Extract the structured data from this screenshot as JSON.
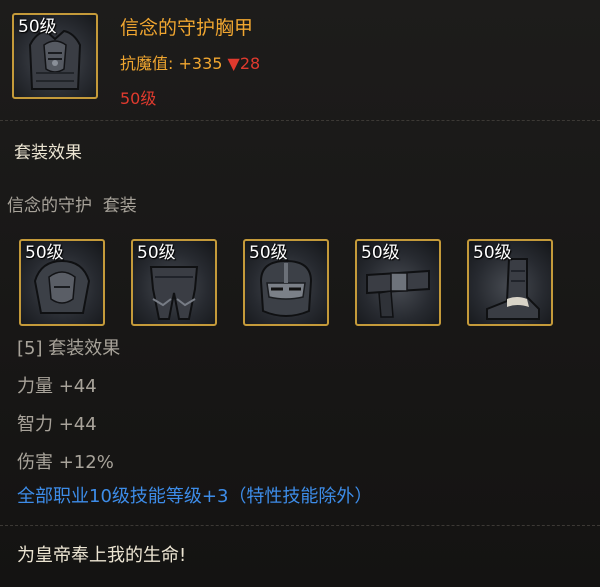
{
  "item": {
    "level_badge": "50级",
    "icon": "chest-armor-icon",
    "name": "信念的守护胸甲",
    "stat_label": "抗魔值",
    "stat_sep": ": ",
    "stat_value": "+335",
    "stat_diff": "▼28",
    "required_level": "50级"
  },
  "set": {
    "section_title": "套装效果",
    "name_line": "信念的守护  套装",
    "pieces": [
      {
        "level": "50级",
        "icon": "shoulder-armor-icon"
      },
      {
        "level": "50级",
        "icon": "leg-armor-icon"
      },
      {
        "level": "50级",
        "icon": "helmet-icon"
      },
      {
        "level": "50级",
        "icon": "belt-icon"
      },
      {
        "level": "50级",
        "icon": "boots-icon"
      }
    ],
    "bonus_header": "[5] 套装效果",
    "bonuses": [
      "力量 +44",
      "智力 +44",
      "伤害 +12%"
    ],
    "skill_bonus": "全部职业10级技能等级+3（特性技能除外）"
  },
  "flavor_text": "为皇帝奉上我的生命!",
  "colors": {
    "gold": "#f0a630",
    "red": "#e03a2e",
    "blue": "#3d8ce8",
    "grey": "#a8a39a",
    "frame": "#c49a3a"
  }
}
